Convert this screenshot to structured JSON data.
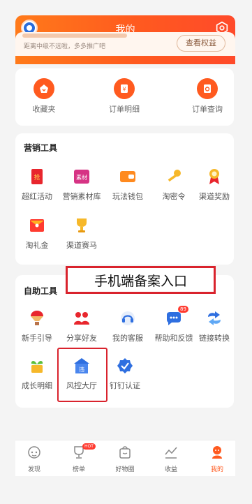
{
  "header": {
    "title": "我的"
  },
  "level": {
    "hint": "距离中级不远啦，多多推广吧",
    "rights_button": "查看权益"
  },
  "quick_actions": [
    {
      "label": "收藏夹",
      "icon": "favorites-icon"
    },
    {
      "label": "订单明细",
      "icon": "order-detail-icon"
    },
    {
      "label": "订单查询",
      "icon": "order-search-icon"
    }
  ],
  "marketing": {
    "title": "营销工具",
    "items": [
      {
        "label": "超红活动",
        "icon": "red-envelope-icon",
        "glyph": "抢"
      },
      {
        "label": "营销素材库",
        "icon": "material-library-icon",
        "glyph": "素材"
      },
      {
        "label": "玩法钱包",
        "icon": "wallet-icon"
      },
      {
        "label": "淘密令",
        "icon": "key-icon"
      },
      {
        "label": "渠道奖励",
        "icon": "medal-icon"
      },
      {
        "label": "淘礼金",
        "icon": "gift-money-icon"
      },
      {
        "label": "渠道赛马",
        "icon": "trophy-icon"
      }
    ]
  },
  "self_help": {
    "title": "自助工具",
    "items": [
      {
        "label": "新手引导",
        "icon": "hot-air-balloon-icon"
      },
      {
        "label": "分享好友",
        "icon": "share-friends-icon"
      },
      {
        "label": "我的客服",
        "icon": "customer-service-icon"
      },
      {
        "label": "帮助和反馈",
        "icon": "help-feedback-icon",
        "badge": "89"
      },
      {
        "label": "链接转换",
        "icon": "link-convert-icon"
      },
      {
        "label": "成长明细",
        "icon": "growth-icon"
      },
      {
        "label": "风控大厅",
        "icon": "risk-control-hall-icon",
        "glyph": "违"
      },
      {
        "label": "钉钉认证",
        "icon": "dingtalk-verify-icon"
      }
    ]
  },
  "annotation": {
    "text": "手机端备案入口"
  },
  "tabbar": [
    {
      "label": "发现",
      "icon": "discover-icon"
    },
    {
      "label": "榜单",
      "icon": "ranking-icon",
      "badge": "HOT"
    },
    {
      "label": "好物圈",
      "icon": "good-items-icon"
    },
    {
      "label": "收益",
      "icon": "earnings-icon"
    },
    {
      "label": "我的",
      "icon": "profile-icon",
      "active": true
    }
  ],
  "colors": {
    "brand": "#ff5a1f",
    "annotation": "#d9232d"
  }
}
